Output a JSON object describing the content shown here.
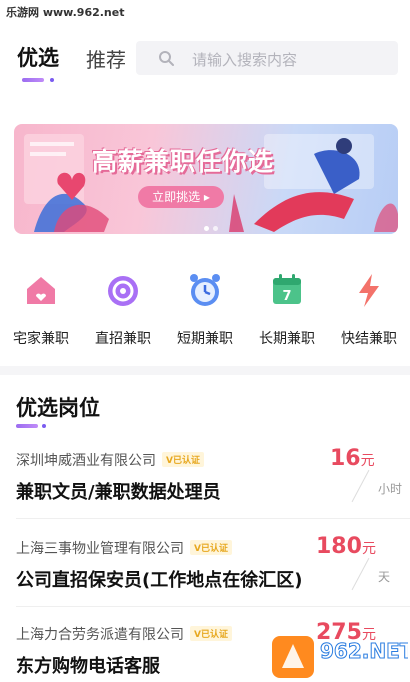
{
  "watermark": {
    "top_text": "乐游网 www.962.net",
    "logo_text": "962.NET",
    "logo_sub": "乐游网"
  },
  "tabs": [
    {
      "label": "优选"
    },
    {
      "label": "推荐"
    }
  ],
  "search": {
    "placeholder": "请输入搜索内容"
  },
  "banner": {
    "title": "高薪兼职任你选",
    "button": "立即挑选 ▸"
  },
  "categories": [
    {
      "label": "宅家兼职",
      "icon": "home-icon"
    },
    {
      "label": "直招兼职",
      "icon": "target-icon"
    },
    {
      "label": "短期兼职",
      "icon": "alarm-clock-icon"
    },
    {
      "label": "长期兼职",
      "icon": "calendar-icon"
    },
    {
      "label": "快结兼职",
      "icon": "lightning-icon"
    }
  ],
  "section": {
    "title": "优选岗位"
  },
  "jobs": [
    {
      "company": "深圳坤威酒业有限公司",
      "badge": "V已认证",
      "title": "兼职文员/兼职数据处理员",
      "price": "16",
      "price_unit": "元",
      "period": "小时"
    },
    {
      "company": "上海三事物业管理有限公司",
      "badge": "V已认证",
      "title": "公司直招保安员(工作地点在徐汇区)",
      "price": "180",
      "price_unit": "元",
      "period": "天"
    },
    {
      "company": "上海力合劳务派遣有限公司",
      "badge": "V已认证",
      "title": "东方购物电话客服",
      "price": "275",
      "price_unit": "元",
      "period": ""
    }
  ],
  "colors": {
    "accent": "#8b5cf6",
    "price": "#e84a5f",
    "banner_pink": "#f07aa6"
  }
}
